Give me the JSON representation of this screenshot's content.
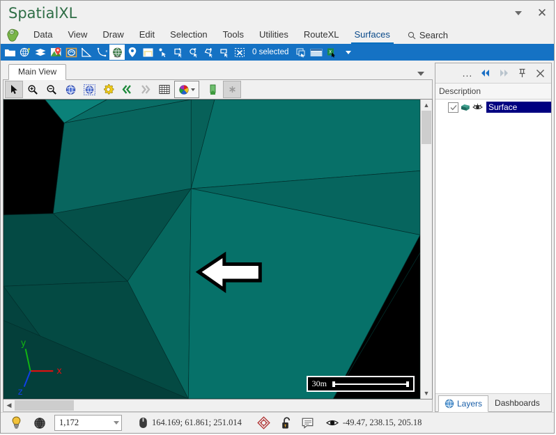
{
  "window": {
    "title": "SpatialXL",
    "dropdown_icon": "chevron-down-icon",
    "close_icon": "close-icon"
  },
  "menubar": {
    "logo_icon": "app-logo-icon",
    "items": [
      {
        "label": "Data",
        "active": false
      },
      {
        "label": "View",
        "active": false
      },
      {
        "label": "Draw",
        "active": false
      },
      {
        "label": "Edit",
        "active": false
      },
      {
        "label": "Selection",
        "active": false
      },
      {
        "label": "Tools",
        "active": false
      },
      {
        "label": "Utilities",
        "active": false
      },
      {
        "label": "RouteXL",
        "active": false
      },
      {
        "label": "Surfaces",
        "active": true
      }
    ],
    "search": {
      "label": "Search",
      "icon": "search-icon"
    }
  },
  "ribbon": {
    "buttons": [
      {
        "name": "open-folder-icon"
      },
      {
        "name": "globe-palette-icon"
      },
      {
        "name": "layers-stack-icon"
      },
      {
        "name": "map-pin-image-icon"
      },
      {
        "name": "boundary-icon"
      },
      {
        "name": "triangle-measure-icon"
      },
      {
        "name": "curve-points-icon"
      },
      {
        "name": "globe-3d-icon"
      },
      {
        "name": "place-marker-icon"
      },
      {
        "name": "note-window-icon"
      },
      {
        "name": "select-point-icon"
      },
      {
        "name": "select-rectangle-icon"
      },
      {
        "name": "select-circle-icon"
      },
      {
        "name": "select-polygon-icon"
      },
      {
        "name": "select-fence-icon"
      },
      {
        "name": "clear-selection-icon"
      }
    ],
    "selected_index": 7,
    "status_label": "0 selected",
    "trailing_buttons": [
      {
        "name": "copy-selection-icon"
      },
      {
        "name": "table-view-icon"
      },
      {
        "name": "export-excel-icon"
      }
    ],
    "overflow_icon": "overflow-caret-icon"
  },
  "doc": {
    "tab_label": "Main View",
    "tab_menu_icon": "tab-menu-caret-icon",
    "view_toolbar": [
      {
        "name": "select-arrow-tool",
        "state": "pressed"
      },
      {
        "name": "zoom-in-icon",
        "state": "normal"
      },
      {
        "name": "zoom-out-icon",
        "state": "normal"
      },
      {
        "name": "globe-view-icon",
        "state": "normal"
      },
      {
        "name": "globe-select-icon",
        "state": "normal"
      },
      {
        "name": "settings-gear-icon",
        "state": "normal"
      },
      {
        "name": "previous-double-chevron-icon",
        "state": "normal"
      },
      {
        "name": "next-double-chevron-icon",
        "state": "normal"
      },
      {
        "name": "grid-icon",
        "state": "normal"
      },
      {
        "name": "color-palette-icon",
        "state": "framed"
      },
      {
        "name": "bookmark-flag-icon",
        "state": "normal"
      },
      {
        "name": "asterisk-icon",
        "state": "pressed"
      }
    ]
  },
  "viewport": {
    "scalebar_label": "30m",
    "axes": [
      {
        "label": "x",
        "color": "#e01010"
      },
      {
        "label": "y",
        "color": "#12b512"
      },
      {
        "label": "z",
        "color": "#1040e8"
      }
    ],
    "annotation_icon": "left-arrow-annotation",
    "surface_colors": {
      "background": "#000000",
      "face_light": "#0a7a71",
      "face_mid": "#07605a",
      "face_dark": "#044a44",
      "face_darker": "#033c38",
      "edge": "#022d2a"
    }
  },
  "right_panel": {
    "header_buttons": [
      {
        "name": "more-options-icon",
        "glyph": "..."
      },
      {
        "name": "collapse-left-icon"
      },
      {
        "name": "expand-right-icon"
      },
      {
        "name": "pin-icon"
      },
      {
        "name": "close-panel-icon"
      }
    ],
    "column_header": "Description",
    "tree_items": [
      {
        "label": "Surface",
        "checked": true,
        "selected": true,
        "icons": [
          "cube-icon",
          "visibility-eye-icon"
        ]
      }
    ],
    "tabs": [
      {
        "label": "Layers",
        "icon": "globe-icon",
        "active": true
      },
      {
        "label": "Dashboards",
        "icon": "",
        "active": false
      }
    ]
  },
  "statusbar": {
    "lightbulb_icon": "lightbulb-icon",
    "globe_wire_icon": "wireframe-globe-icon",
    "scale_value": "1,172",
    "mouse_icon": "mouse-icon",
    "mouse_coords": "164.169; 61.861; 251.014",
    "target_icon": "snap-target-icon",
    "lock_icon": "unlocked-padlock-icon",
    "message_icon": "message-balloon-icon",
    "eye_icon": "eye-icon",
    "view_coords": "-49.47, 238.15, 205.18"
  }
}
